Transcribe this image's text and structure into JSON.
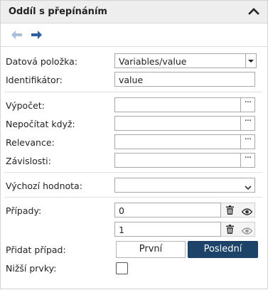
{
  "panel": {
    "title": "Oddíl s přepínáním",
    "collapse_icon": "chevron-up-icon"
  },
  "toolbar": {
    "back_icon": "arrow-left-icon",
    "forward_icon": "arrow-right-icon"
  },
  "fields": {
    "data_item": {
      "label": "Datová položka:",
      "value": "Variables/value"
    },
    "identifier": {
      "label": "Identifikátor:",
      "value": "value"
    },
    "calculation": {
      "label": "Výpočet:",
      "value": "",
      "button": "···"
    },
    "not_calc_when": {
      "label": "Nepočítat když:",
      "value": "",
      "button": "···"
    },
    "relevance": {
      "label": "Relevance:",
      "value": "",
      "button": "···"
    },
    "dependencies": {
      "label": "Závislosti:",
      "value": "",
      "button": "···"
    },
    "default_value": {
      "label": "Výchozí hodnota:",
      "value": ""
    }
  },
  "cases": {
    "label": "Případy:",
    "items": [
      {
        "value": "0"
      },
      {
        "value": "1"
      }
    ]
  },
  "add_case": {
    "label": "Přidat případ:",
    "first_label": "První",
    "last_label": "Poslední"
  },
  "lower_items": {
    "label": "Nižší prvky:",
    "checked": false
  },
  "colors": {
    "accent": "#1d4369",
    "forward_arrow": "#2f5e9e",
    "back_arrow": "#a9bfd9"
  }
}
